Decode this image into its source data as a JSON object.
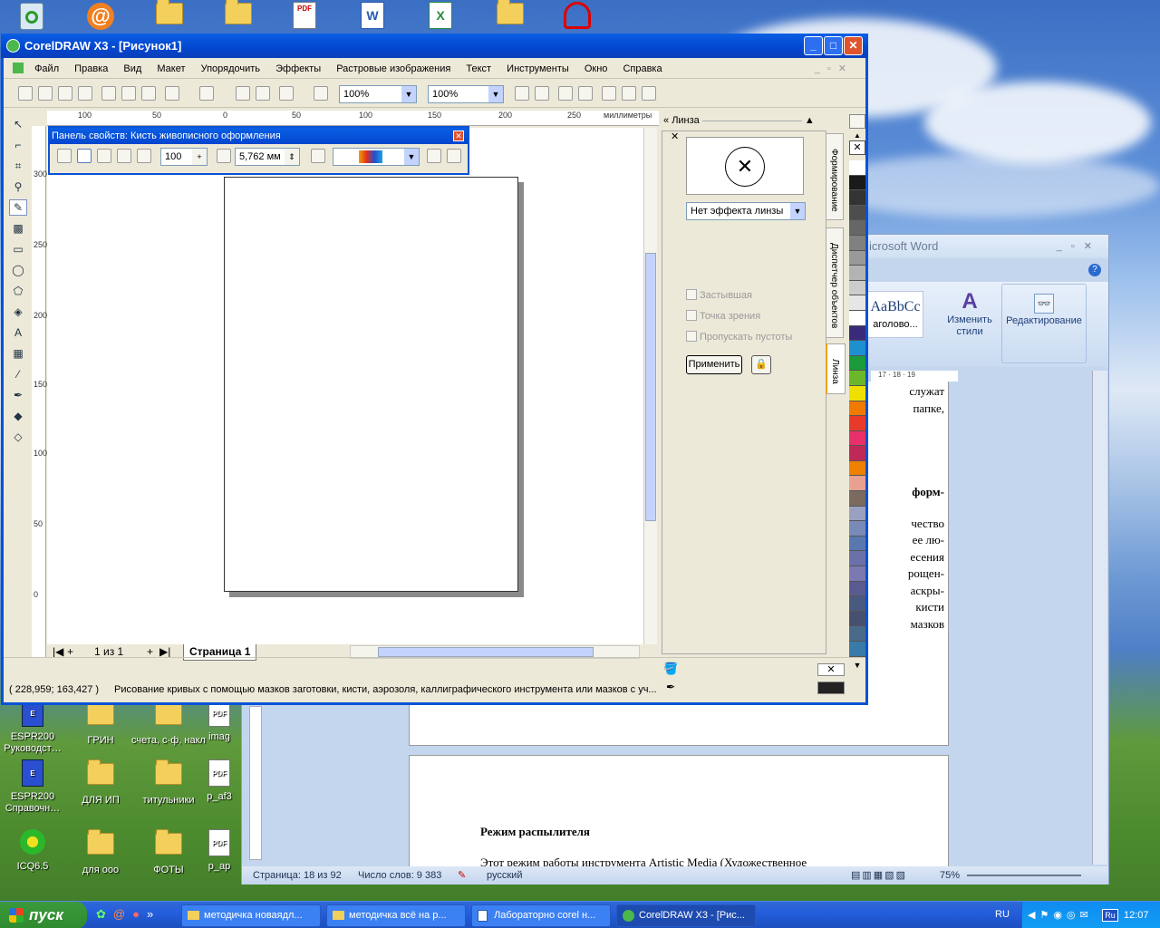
{
  "desktop": {
    "top_icons": [
      "recycle-bin",
      "agent-mail",
      "folder",
      "folder",
      "pdf",
      "word",
      "excel",
      "folder",
      "media"
    ],
    "icons": [
      {
        "label": "ESPR200 Руководст…"
      },
      {
        "label": "ГРИН"
      },
      {
        "label": "счета, с-ф, накл"
      },
      {
        "label": "imag"
      },
      {
        "label": "ESPR200 Справочн…"
      },
      {
        "label": "ДЛЯ ИП"
      },
      {
        "label": "титульники"
      },
      {
        "label": "p_af3"
      },
      {
        "label": "ICQ6.5"
      },
      {
        "label": "для ооо"
      },
      {
        "label": "ФОТЫ"
      },
      {
        "label": "p_ap"
      }
    ]
  },
  "word": {
    "title": "icrosoft Word",
    "style_preview": "AaBbCc",
    "style_name": "аголово...",
    "change_styles": "Изменить стили",
    "editing": "Редактирование",
    "ruler_marks": [
      "17",
      "18",
      "19"
    ],
    "page1_lines": [
      "служат",
      "папке,",
      "форм-",
      "чество",
      "ее лю-",
      "есения",
      "рощен-",
      "аскры-",
      "кисти",
      "мазков"
    ],
    "page2_heading": "Режим распылителя",
    "page2_text": "Этот режим работы инструмента Artistic Media (Художественное",
    "status": {
      "page": "Страница: 18 из 92",
      "words": "Число слов: 9 383",
      "lang": "русский",
      "zoom": "75%"
    }
  },
  "corel": {
    "title": "CorelDRAW X3 - [Рисунок1]",
    "menu": [
      "Файл",
      "Правка",
      "Вид",
      "Макет",
      "Упорядочить",
      "Эффекты",
      "Растровые изображения",
      "Текст",
      "Инструменты",
      "Окно",
      "Справка"
    ],
    "zoom1": "100%",
    "zoom2": "100%",
    "ruler_unit": "миллиметры",
    "h_ruler": [
      "100",
      "50",
      "0",
      "50",
      "100",
      "150",
      "200",
      "250"
    ],
    "v_ruler": [
      "300",
      "250",
      "200",
      "150",
      "100",
      "50",
      "0"
    ],
    "props": {
      "title": "Панель свойств: Кисть живописного оформления",
      "value1": "100",
      "value2": "5,762 мм"
    },
    "docker": {
      "title": "Линза",
      "effect": "Нет эффекта линзы",
      "frozen": "Застывшая",
      "viewpoint": "Точка зрения",
      "remove_face": "Пропускать пустоты",
      "apply": "Применить"
    },
    "docker_tabs": [
      "Формирование",
      "Диспетчер объектов",
      "Линза"
    ],
    "page_nav": {
      "count": "1 из 1",
      "page_tab": "Страница 1"
    },
    "status": {
      "coords": "( 228,959; 163,427 )",
      "hint": "Рисование кривых с помощью мазков заготовки, кисти, аэрозоля, каллиграфического инструмента или мазков с уч..."
    },
    "palette": [
      "#ffffff",
      "#1a1a1a",
      "#333333",
      "#4d4d4d",
      "#666666",
      "#808080",
      "#999999",
      "#b3b3b3",
      "#cccccc",
      "#e6e6e6",
      "#ffffff",
      "#3a2a7a",
      "#1e90d0",
      "#1a9a3a",
      "#6ab82a",
      "#f0e000",
      "#f07a00",
      "#e83a2a",
      "#e8306a",
      "#c0285a",
      "#f08000",
      "#e8a090",
      "#7a6a60",
      "#9aa0c0",
      "#7a8ab8",
      "#5a78b0",
      "#6a70a8",
      "#7a7ab0",
      "#5a5a90",
      "#485a80",
      "#485070",
      "#4a6a8a",
      "#3a7aa8"
    ]
  },
  "taskbar": {
    "start": "пуск",
    "tasks": [
      "методичка новаядл...",
      "методичка всё на р...",
      "Лабораторно corel н...",
      "CorelDRAW X3 - [Рис..."
    ],
    "lang": "RU",
    "time": "12:07"
  }
}
